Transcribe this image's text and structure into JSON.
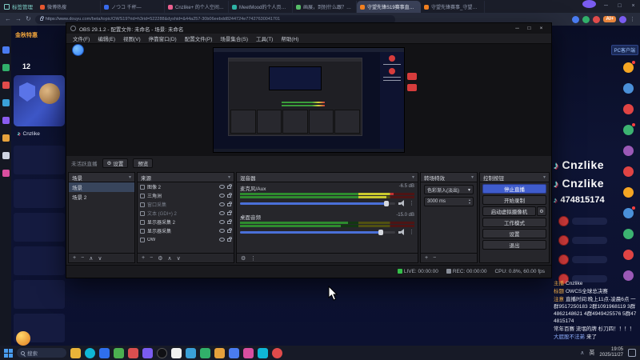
{
  "colors": {
    "accent_blue": "#3f5ccc",
    "live_green": "#35c04a",
    "brand_orange": "#f0a43c",
    "douyin_cyan": "#25f4ee",
    "douyin_red": "#fe2c55"
  },
  "browser": {
    "tab_manager": "标签管理",
    "tabs": [
      {
        "label": "微博热搜"
      },
      {
        "label": "ノつコ 千杯—"
      },
      {
        "label": "Cnzlike+ 的个人空间-Cnzlike·哔…"
      },
      {
        "label": "MeetMood的个人页面-M…"
      },
      {
        "label": "画展，到别什么跟？全屏探…"
      },
      {
        "label": "守望先锋S19赛事直播确定室_C…"
      },
      {
        "label": "守望先锋赛事_守望先锋直播…"
      }
    ],
    "active_tab_index": 5,
    "nav": {
      "back": "←",
      "forward": "→",
      "reload": "↻"
    },
    "url": "https://www.douyu.com/beta/topic/OWS19?rid=h3rid=522288&dyshid=&44a257-30b06eebdd8244724e77427630041701",
    "ai_badge": "AI+",
    "win_controls": {
      "min": "─",
      "max": "□",
      "close": "×"
    }
  },
  "page": {
    "promo": "金秋特惠",
    "left_badge": "12",
    "streamer_name": "Cnzlike",
    "client_chip": "PC客户端",
    "chat": {
      "brand_line1": "Cnzlike",
      "brand_line2": "Cnzlike",
      "room_id": "474815174",
      "note_icon": "♪",
      "messages": [
        {
          "badge": "主播",
          "text": "Cnzlike"
        },
        {
          "badge": "标题",
          "text": "OWCS全球总决赛"
        },
        {
          "badge": "注意",
          "text": "直播时间:晚上11点-凌晨6点 一群9517250183 2群1091968119 3群4862148621 4群4949425576 5群474815174"
        },
        {
          "text": "常年百赛 流氓的牌 杉刀四！！！！"
        },
        {
          "user": "大屁股不法弟",
          "text": "来了"
        }
      ]
    }
  },
  "obs": {
    "title": "OBS 29.1.2 - 配置文件: 未命名 - 场景: 未命名",
    "win_controls": {
      "min": "─",
      "max": "□",
      "close": "×"
    },
    "menu": [
      "文件(F)",
      "编辑(E)",
      "视图(V)",
      "停靠窗口(D)",
      "配置文件(P)",
      "场景集合(S)",
      "工具(T)",
      "帮助(H)"
    ],
    "status_label": "未活跃直播",
    "settings_button": "设置",
    "preview_button": "预览",
    "scenes": {
      "title": "场景",
      "items": [
        {
          "name": "场景"
        },
        {
          "name": "场景 2"
        }
      ]
    },
    "sources": {
      "title": "来源",
      "items": [
        {
          "name": "图像 2"
        },
        {
          "name": "三角洲"
        },
        {
          "name": "窗口采集"
        },
        {
          "name": "文本 (GDI+) 2"
        },
        {
          "name": "显示器采集 2"
        },
        {
          "name": "显示器采集"
        },
        {
          "name": "OW"
        }
      ]
    },
    "mixer": {
      "title": "混音器",
      "channels": [
        {
          "name": "麦克风/Aux",
          "db": "-6.5 dB"
        },
        {
          "name": "桌面音频",
          "db": "-15.0 dB"
        }
      ]
    },
    "transitions": {
      "title": "转场特效",
      "selected": "色彩渐入(淡出)",
      "duration": "3000 ms"
    },
    "controls": {
      "title": "控制按钮",
      "buttons": [
        "停止直播",
        "开始录制",
        "启动虚拟摄像机",
        "工作模式",
        "设置",
        "退出"
      ]
    },
    "statusbar": {
      "live": "LIVE: 00:00:00",
      "rec": "REC: 00:00:00",
      "cpu": "CPU: 0.8%, 60.00 fps"
    },
    "icons": {
      "add": "+",
      "remove": "−",
      "gear": "⚙",
      "up": "∧",
      "down": "∨",
      "dots": "⋮",
      "dropdown": "▾",
      "spin_up": "▴",
      "spin_down": "▾"
    }
  },
  "taskbar": {
    "search": "搜索",
    "lang": "英",
    "time": "19:05",
    "date": "2025/11/27",
    "tray_up": "∧"
  }
}
